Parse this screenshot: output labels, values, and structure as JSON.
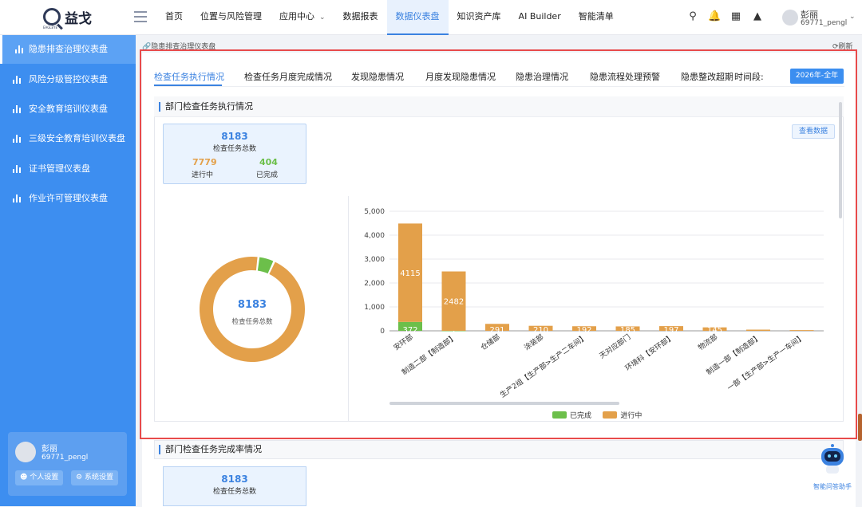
{
  "header": {
    "logo_text": "益戈",
    "logo_sub": "EAGLEYE",
    "nav": [
      {
        "label": "首页",
        "active": false
      },
      {
        "label": "位置与风险管理",
        "active": false
      },
      {
        "label": "应用中心",
        "active": false,
        "has_dropdown": true
      },
      {
        "label": "数据报表",
        "active": false
      },
      {
        "label": "数据仪表盘",
        "active": true
      },
      {
        "label": "知识资产库",
        "active": false
      },
      {
        "label": "AI Builder",
        "active": false
      },
      {
        "label": "智能清单",
        "active": false
      }
    ],
    "tools": [
      "search-icon",
      "bell-icon",
      "qr-code-icon",
      "area-chart-icon"
    ],
    "user_name": "彭丽",
    "user_id": "69771_pengl"
  },
  "sidebar": {
    "items": [
      {
        "label": "隐患排查治理仪表盘",
        "active": true
      },
      {
        "label": "风险分级管控仪表盘",
        "active": false
      },
      {
        "label": "安全教育培训仪表盘",
        "active": false
      },
      {
        "label": "三级安全教育培训仪表盘",
        "active": false
      },
      {
        "label": "证书管理仪表盘",
        "active": false
      },
      {
        "label": "作业许可管理仪表盘",
        "active": false
      }
    ],
    "user_name": "彭丽",
    "user_id": "69771_pengl",
    "personal_settings": "个人设置",
    "system_settings": "系统设置"
  },
  "breadcrumb": "隐患排查治理仪表盘",
  "refresh_label": "刷新",
  "tabs": [
    {
      "label": "检查任务执行情况",
      "active": true
    },
    {
      "label": "检查任务月度完成情况",
      "active": false
    },
    {
      "label": "发现隐患情况",
      "active": false
    },
    {
      "label": "月度发现隐患情况",
      "active": false
    },
    {
      "label": "隐患治理情况",
      "active": false
    },
    {
      "label": "隐患流程处理预警",
      "active": false
    },
    {
      "label": "隐患整改超期预警",
      "active": false
    }
  ],
  "time_label": "时间段:",
  "time_value": "2026年-全年",
  "section1": {
    "title": "部门检查任务执行情况",
    "total_value": "8183",
    "total_label": "检查任务总数",
    "in_progress_value": "7779",
    "in_progress_label": "进行中",
    "completed_value": "404",
    "completed_label": "已完成",
    "view_data": "查看数据"
  },
  "section2": {
    "title": "部门检查任务完成率情况",
    "total_value": "8183",
    "total_label": "检查任务总数"
  },
  "assistant_label": "智能问答助手",
  "colors": {
    "completed": "#6cbf4a",
    "in_progress": "#e3a04a",
    "accent": "#3b82e0"
  },
  "chart_data": [
    {
      "type": "pie",
      "variant": "donut",
      "center_value": "8183",
      "center_label": "检查任务总数",
      "slices": [
        {
          "name": "已完成",
          "value": 404
        },
        {
          "name": "进行中",
          "value": 7779
        }
      ]
    },
    {
      "type": "bar",
      "stacked": true,
      "categories": [
        "安环部",
        "制造二部【制造部】",
        "仓储部",
        "涂装部",
        "生产2组【生产部>生产二车间】",
        "天对应部门",
        "环境科【安环部】",
        "物流部",
        "制造一部【制造部】",
        "一部【生产部>生产一车间】"
      ],
      "series": [
        {
          "name": "已完成",
          "values": [
            372,
            1,
            0,
            0,
            0,
            0,
            0,
            0,
            0,
            0
          ]
        },
        {
          "name": "进行中",
          "values": [
            4115,
            2482,
            291,
            210,
            192,
            185,
            197,
            145,
            50,
            30
          ]
        }
      ],
      "y_ticks": [
        "0",
        "1,000",
        "2,000",
        "3,000",
        "4,000",
        "5,000"
      ],
      "ylim": [
        0,
        5000
      ],
      "legend": [
        "已完成",
        "进行中"
      ],
      "legend_position": "bottom"
    }
  ]
}
